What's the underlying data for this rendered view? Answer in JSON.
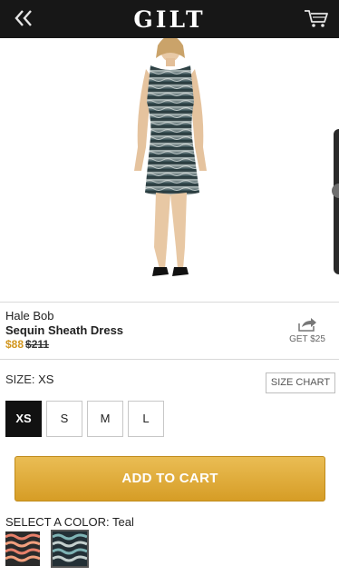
{
  "header": {
    "logo": "GILT",
    "back_icon": "double-chevron-left-icon",
    "cart_icon": "cart-icon"
  },
  "product": {
    "brand": "Hale Bob",
    "name": "Sequin Sheath Dress",
    "sale_price": "$88",
    "original_price": "$211"
  },
  "share": {
    "icon": "share-icon",
    "label": "GET $25"
  },
  "size": {
    "label": "SIZE:",
    "selected": "XS",
    "chart_label": "SIZE CHART",
    "options": [
      "XS",
      "S",
      "M",
      "L"
    ]
  },
  "add_to_cart_label": "ADD TO CART",
  "color": {
    "label": "SELECT A COLOR:",
    "selected": "Teal",
    "swatches": [
      "coral-print",
      "teal-print"
    ]
  },
  "colors": {
    "topbar": "#171717",
    "accent": "#d69d26",
    "sale_price": "#d2961e"
  }
}
